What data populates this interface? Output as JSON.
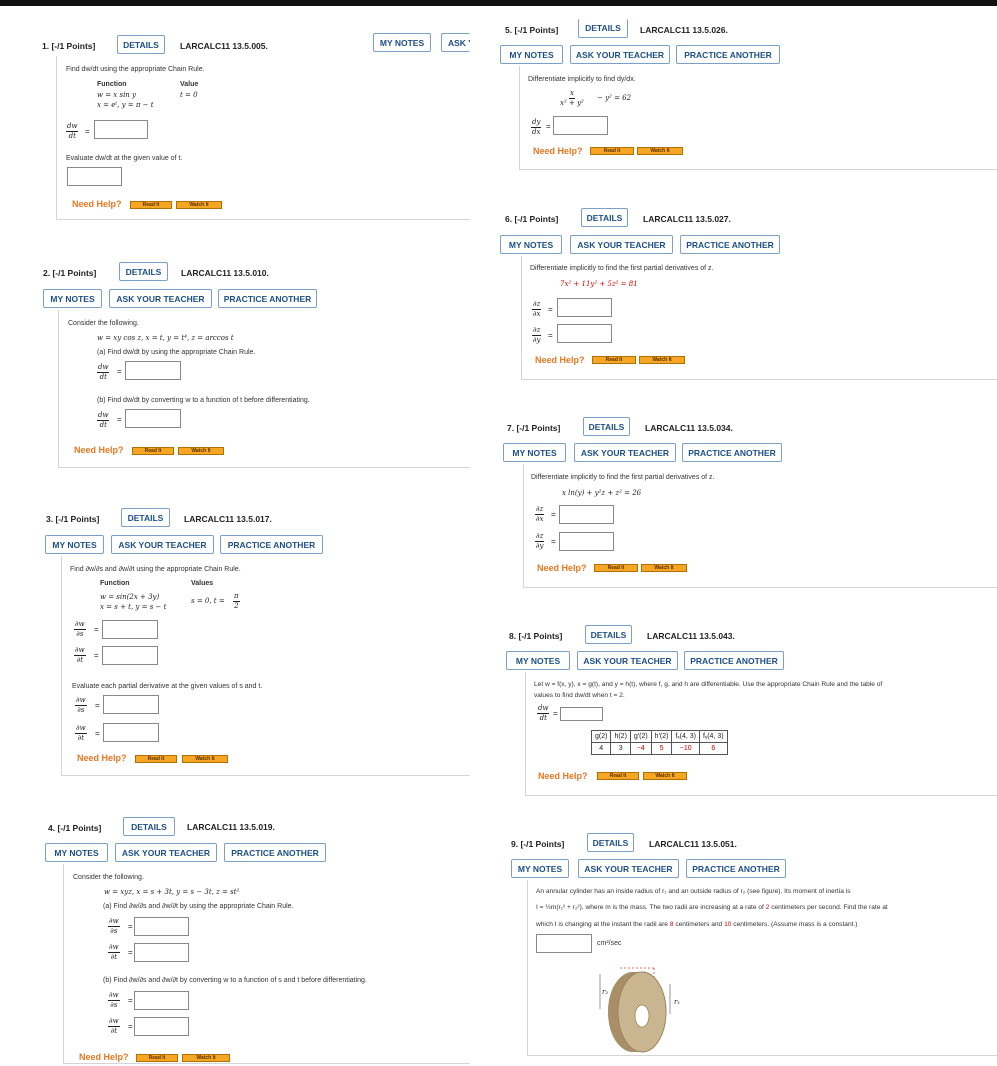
{
  "buttons": {
    "details": "DETAILS",
    "my_notes": "MY NOTES",
    "ask_teacher": "ASK YOUR TEACHER",
    "practice": "PRACTICE ANOTHER",
    "ask_cut": "ASK Y"
  },
  "help": {
    "need_help": "Need Help?",
    "read_it": "Read It",
    "watch_it": "Watch It"
  },
  "q1": {
    "title": "1. [-/1 Points]",
    "code": "LARCALC11 13.5.005.",
    "prompt": "Find dw/dt using the appropriate Chain Rule.",
    "col_function": "Function",
    "col_value": "Value",
    "f1": "w = x sin y",
    "f2": "x = eᵗ, y = π − t",
    "val": "t = 0",
    "dw": "dw",
    "dt": "dt",
    "evaluate": "Evaluate dw/dt at the given value of t."
  },
  "q2": {
    "title": "2. [-/1 Points]",
    "code": "LARCALC11 13.5.010.",
    "consider": "Consider the following.",
    "eq": "w = xy cos z,   x = t,   y = t⁴,   z = arccos t",
    "a": "(a) Find dw/dt by using the appropriate Chain Rule.",
    "b": "(b) Find dw/dt by converting w to a function of t before differentiating.",
    "dw": "dw",
    "dt": "dt"
  },
  "q3": {
    "title": "3. [-/1 Points]",
    "code": "LARCALC11 13.5.017.",
    "prompt": "Find ∂w/∂s and ∂w/∂t using the appropriate Chain Rule.",
    "col_function": "Function",
    "col_values": "Values",
    "f1": "w = sin(2x + 3y)",
    "f2": "x = s + t,  y = s − t",
    "vals": "s = 0,  t =",
    "pi": "π",
    "two": "2",
    "evaluate": "Evaluate each partial derivative at the given values of s and t.",
    "dw": "∂w",
    "ds": "∂s",
    "dt": "∂t"
  },
  "q4": {
    "title": "4. [-/1 Points]",
    "code": "LARCALC11 13.5.019.",
    "consider": "Consider the following.",
    "eq": "w = xyz,   x = s + 3t,   y = s − 3t,   z = st²",
    "a": "(a) Find ∂w/∂s and ∂w/∂t by using the appropriate Chain Rule.",
    "b": "(b) Find ∂w/∂s and ∂w/∂t by converting w to a function of s and t before differentiating.",
    "dw": "∂w",
    "ds": "∂s",
    "dt": "∂t"
  },
  "q5": {
    "title": "5. [-/1 Points]",
    "code": "LARCALC11 13.5.026.",
    "prompt": "Differentiate implicitly to find dy/dx.",
    "num": "x",
    "den": "x² + y²",
    "rest": "− y² = 62",
    "dy": "dy",
    "dx": "dx"
  },
  "q6": {
    "title": "6. [-/1 Points]",
    "code": "LARCALC11 13.5.027.",
    "prompt": "Differentiate implicitly to find the first partial derivatives of z.",
    "eq": "7x² + 11y² + 5z² = 81",
    "dz": "∂z",
    "dx": "∂x",
    "dy": "∂y"
  },
  "q7": {
    "title": "7. [-/1 Points]",
    "code": "LARCALC11 13.5.034.",
    "prompt": "Differentiate implicitly to find the first partial derivatives of z.",
    "eq": "x ln(y) + y²z + z² = 26",
    "dz": "∂z",
    "dx": "∂x",
    "dy": "∂y"
  },
  "q8": {
    "title": "8. [-/1 Points]",
    "code": "LARCALC11 13.5.043.",
    "prompt1": "Let w = f(x, y), x = g(t), and y = h(t), where f, g, and h are differentiable. Use the appropriate Chain Rule and the table of",
    "prompt2": "values to find dw/dt when t = 2.",
    "dw": "dw",
    "dt": "dt",
    "table_headers": [
      "g(2)",
      "h(2)",
      "g′(2)",
      "h′(2)",
      "fₓ(4, 3)",
      "fᵧ(4, 3)"
    ],
    "table_values": [
      "4",
      "3",
      "−4",
      "5",
      "−10",
      "6"
    ]
  },
  "q9": {
    "title": "9. [-/1 Points]",
    "code": "LARCALC11 13.5.051.",
    "l1": "An annular cylinder has an inside radius of r₁ and an outside radius of r₂ (see figure). Its moment of inertia is",
    "l2a": "I = ½m(r₁² + r₂²),  where m is the mass. The two radii are increasing at a rate of",
    "rate": "2",
    "l2b": "centimeters per second. Find the rate at",
    "l3a": "which I is changing at the instant the radii are",
    "r1v": "8",
    "l3b": "centimeters and",
    "r2v": "10",
    "l3c": "centimeters. (Assume mass is a constant.)",
    "unit": "cm²/sec",
    "fig_r1": "r₁",
    "fig_r2": "r₂"
  }
}
